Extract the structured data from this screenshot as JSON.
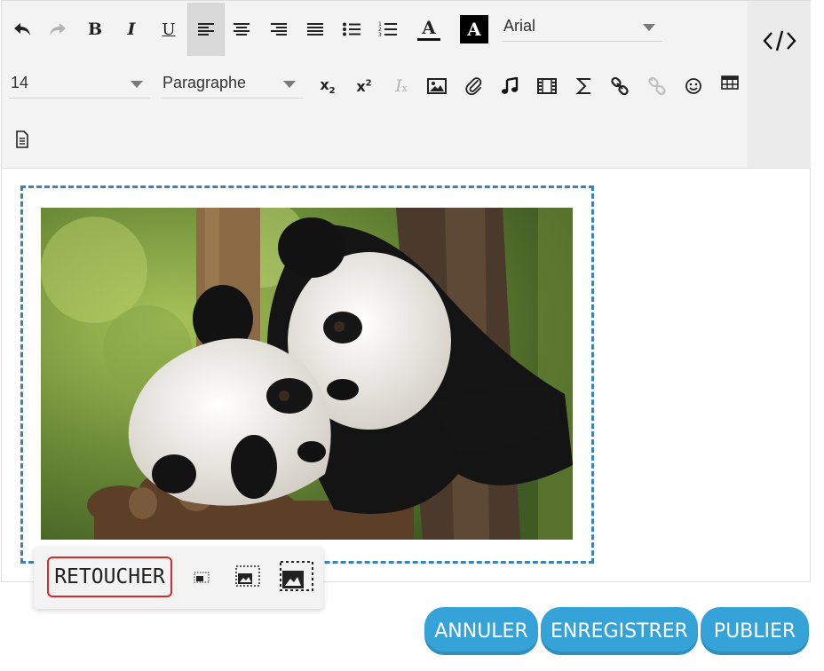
{
  "toolbar": {
    "undo_icon": "undo-icon",
    "redo_icon": "redo-icon",
    "bold_label": "B",
    "italic_label": "I",
    "underline_label": "U",
    "font_family": {
      "value": "Arial"
    },
    "font_size": {
      "value": "14"
    },
    "block_format": {
      "value": "Paragraphe"
    },
    "subscript_label": "x",
    "superscript_label": "x",
    "script_digit": "2",
    "text_color_label": "A",
    "bg_color_label": "A",
    "clear_format_label": "I",
    "clear_format_mark": "x"
  },
  "image_popup": {
    "retouch_label": "RETOUCHER"
  },
  "actions": {
    "cancel_label": "ANNULER",
    "save_label": "ENREGISTRER",
    "publish_label": "PUBLIER"
  },
  "colors": {
    "accent": "#35a2d8",
    "frame_dash": "#3c82b4",
    "highlight": "#d42b2b"
  }
}
